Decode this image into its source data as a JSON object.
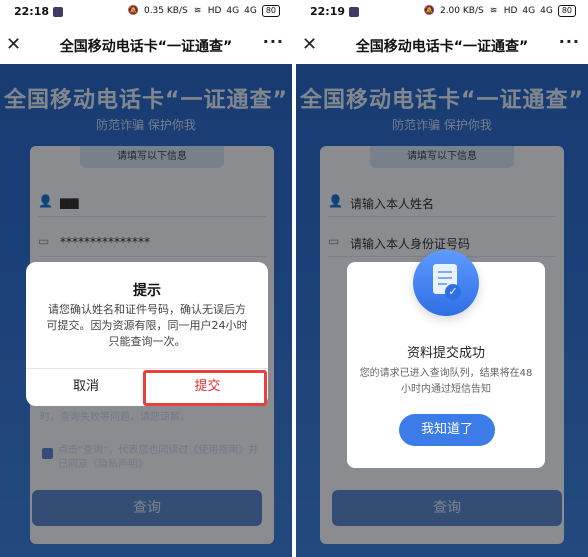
{
  "left": {
    "status": {
      "time": "22:18",
      "net": "0.35 KB/S",
      "hd": "HD",
      "sig1": "4G",
      "sig2": "4G",
      "battery": "80"
    },
    "nav": {
      "title": "全国移动电话卡“一证通查”",
      "close": "✕",
      "more": "···"
    },
    "hero": {
      "title": "全国移动电话卡“一证通查”",
      "subtitle": "防范诈骗 保护你我"
    },
    "form": {
      "header": "请填写以下信息",
      "name_value": "▆▆",
      "id_value": "***************"
    },
    "note": {
      "partial": "时，查询失败等问题，请您谅解。",
      "agree": "点击“查询”，代表您也同读过《使用指南》并已同意《隐私声明》"
    },
    "query_button": "查询",
    "dialog": {
      "title": "提示",
      "body": "请您确认姓名和证件号码，确认无误后方可提交。因为资源有限，同一用户24小时只能查询一次。",
      "cancel": "取消",
      "submit": "提交"
    }
  },
  "right": {
    "status": {
      "time": "22:19",
      "net": "2.00 KB/S",
      "hd": "HD",
      "sig1": "4G",
      "sig2": "4G",
      "battery": "80"
    },
    "nav": {
      "title": "全国移动电话卡“一证通查”",
      "close": "✕",
      "more": "···"
    },
    "hero": {
      "title": "全国移动电话卡“一证通查”",
      "subtitle": "防范诈骗 保护你我"
    },
    "form": {
      "header": "请填写以下信息",
      "name_placeholder": "请输入本人姓名",
      "id_placeholder": "请输入本人身份证号码"
    },
    "query_button": "查询",
    "success": {
      "title": "资料提交成功",
      "desc": "您的请求已进入查询队列，结果将在48小时内通过短信告知",
      "button": "我知道了"
    }
  }
}
